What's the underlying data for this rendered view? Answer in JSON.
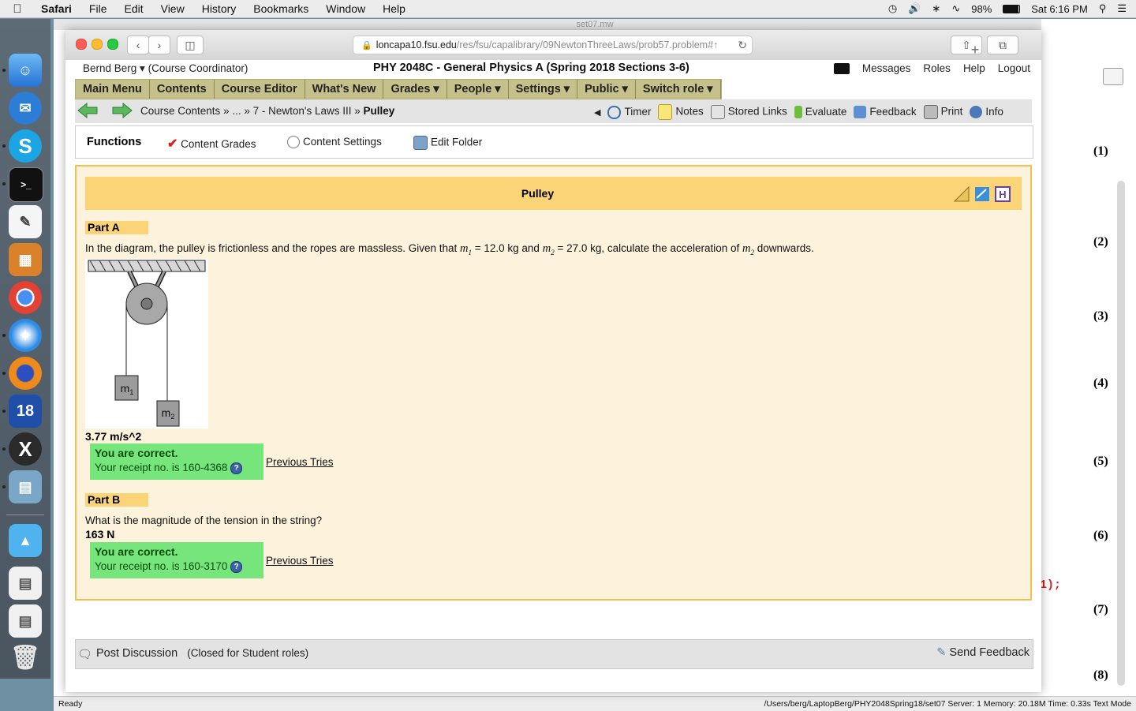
{
  "menubar": {
    "app": "Safari",
    "items": [
      "File",
      "Edit",
      "View",
      "History",
      "Bookmarks",
      "Window",
      "Help"
    ],
    "battery": "98%",
    "clock": "Sat 6:16 PM"
  },
  "bg_window": {
    "title": "set07.mw",
    "equation_numbers": [
      "(1)",
      "(2)",
      "(3)",
      "(4)",
      "(5)",
      "(6)",
      "(7)",
      "(8)"
    ],
    "code_fragment": "1);",
    "status_left": "Ready",
    "status_right": "/Users/berg/LaptopBerg/PHY2048Spring18/set07   Server: 1   Memory: 20.18M   Time: 0.33s   Text Mode"
  },
  "browser": {
    "url_host": "loncapa10.fsu.edu",
    "url_path": "/res/fsu/capalibrary/09NewtonThreeLaws/prob57.problem#",
    "url_tail": "↑"
  },
  "header": {
    "user": "Bernd Berg ▾",
    "role": "(Course Coordinator)",
    "course": "PHY 2048C - General Physics A (Spring 2018 Sections 3-6)",
    "links": [
      "Messages",
      "Roles",
      "Help",
      "Logout"
    ]
  },
  "main_menu": [
    "Main Menu",
    "Contents",
    "Course Editor",
    "What's New",
    "Grades ▾",
    "People ▾",
    "Settings ▾",
    "Public ▾",
    "Switch role ▾"
  ],
  "nav": {
    "crumb1": "Course Contents »",
    "crumb2": "... »",
    "crumb3": "7 - Newton's Laws III »",
    "current": "Pulley",
    "tools": [
      "Timer",
      "Notes",
      "Stored Links",
      "Evaluate",
      "Feedback",
      "Print",
      "Info"
    ]
  },
  "functions": {
    "title": "Functions",
    "items": [
      "Content Grades",
      "Content Settings",
      "Edit Folder"
    ]
  },
  "problem": {
    "title": "Pulley",
    "part_a": {
      "label": "Part A",
      "q_pre": "In the diagram, the pulley is frictionless and the ropes are massless. Given that",
      "m1_val": "= 12.0 kg and",
      "m2_val": "= 27.0 kg, calculate the acceleration of",
      "q_post": "downwards.",
      "diagram_m1": "m",
      "diagram_m2": "m",
      "answer": "3.77 m/s^2",
      "correct": "You are correct.",
      "receipt": "Your receipt no. is 160-4368",
      "previous": "Previous Tries"
    },
    "part_b": {
      "label": "Part B",
      "question": "What is the magnitude of the tension in the string?",
      "answer": "163 N",
      "correct": "You are correct.",
      "receipt": "Your receipt no. is 160-3170",
      "previous": "Previous Tries"
    }
  },
  "discussion": {
    "post": "Post Discussion",
    "closed": "(Closed for Student roles)",
    "send_feedback": "Send Feedback"
  }
}
